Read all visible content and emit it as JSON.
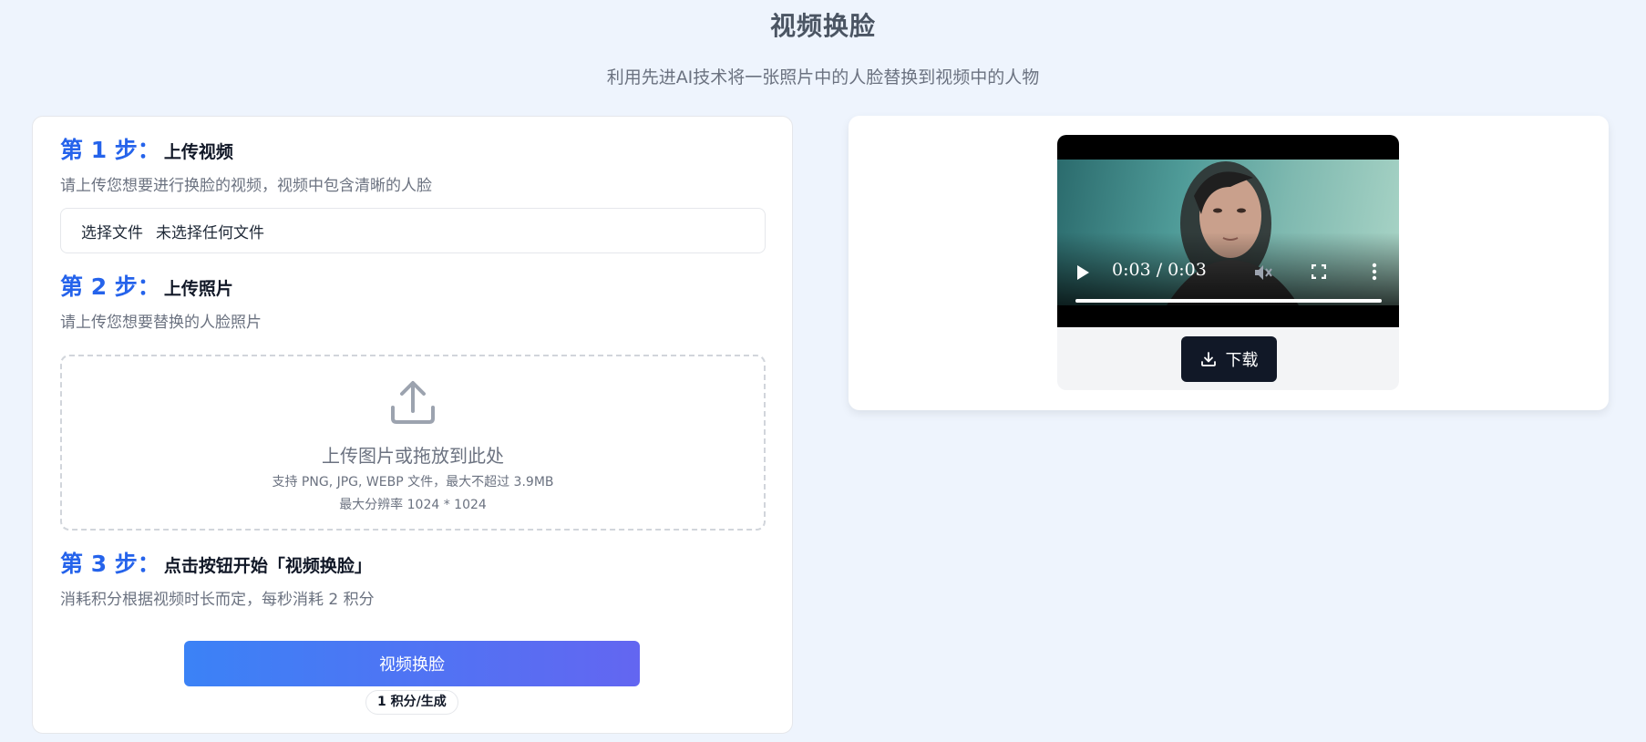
{
  "page": {
    "title": "视频换脸",
    "subtitle": "利用先进AI技术将一张照片中的人脸替换到视频中的人物"
  },
  "step1": {
    "number": "第 1 步：",
    "title": "上传视频",
    "desc": "请上传您想要进行换脸的视频，视频中包含清晰的人脸",
    "file_button": "选择文件",
    "file_status": "未选择任何文件"
  },
  "step2": {
    "number": "第 2 步：",
    "title": "上传照片",
    "desc": "请上传您想要替换的人脸照片",
    "dropzone_main": "上传图片或拖放到此处",
    "dropzone_formats": "支持 PNG, JPG, WEBP 文件，最大不超过 3.9MB",
    "dropzone_resolution": "最大分辨率 1024 * 1024",
    "icon": "upload-icon"
  },
  "step3": {
    "number": "第 3 步：",
    "title": "点击按钮开始「视频换脸」",
    "desc": "消耗积分根据视频时长而定，每秒消耗 2 积分",
    "button": "视频换脸",
    "cost_badge": "1 积分/生成"
  },
  "result": {
    "video_time": "0:03 / 0:03",
    "progress": 1.0,
    "download_label": "下载",
    "icons": [
      "play-icon",
      "volume-muted-icon",
      "fullscreen-icon",
      "more-options-icon",
      "download-icon"
    ]
  },
  "colors": {
    "accent": "#2563eb",
    "button_gradient_start": "#3b82f6",
    "button_gradient_end": "#6366f1",
    "background": "#eef4fd",
    "download_bg": "#111827"
  }
}
